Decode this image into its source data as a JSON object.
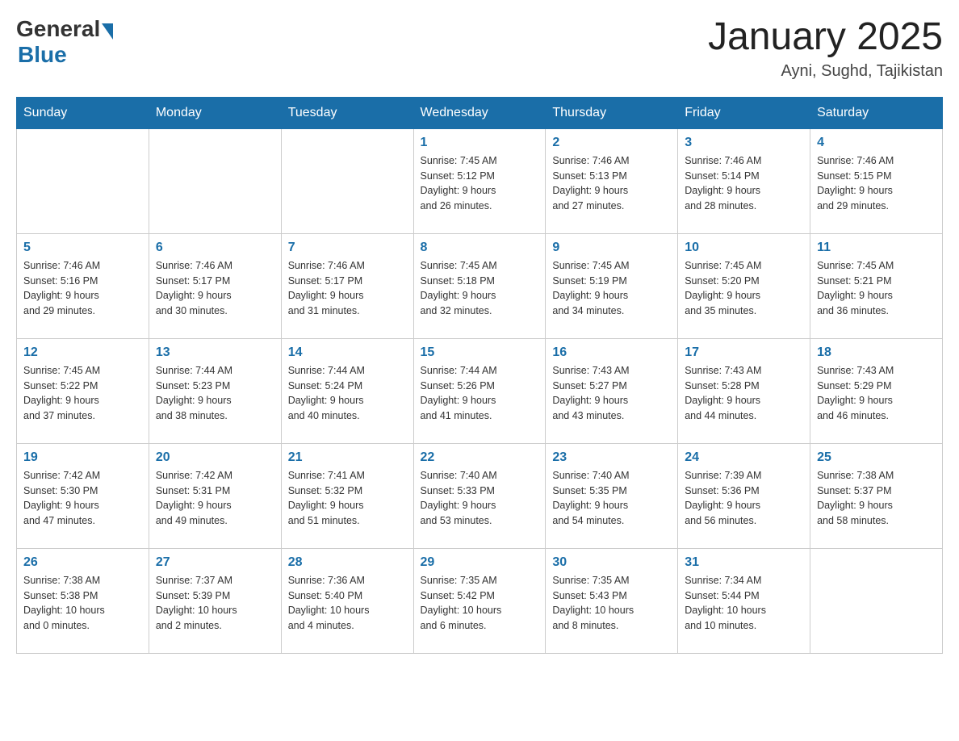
{
  "logo": {
    "general": "General",
    "blue": "Blue"
  },
  "title": "January 2025",
  "location": "Ayni, Sughd, Tajikistan",
  "days_of_week": [
    "Sunday",
    "Monday",
    "Tuesday",
    "Wednesday",
    "Thursday",
    "Friday",
    "Saturday"
  ],
  "weeks": [
    [
      {
        "day": "",
        "info": ""
      },
      {
        "day": "",
        "info": ""
      },
      {
        "day": "",
        "info": ""
      },
      {
        "day": "1",
        "info": "Sunrise: 7:45 AM\nSunset: 5:12 PM\nDaylight: 9 hours\nand 26 minutes."
      },
      {
        "day": "2",
        "info": "Sunrise: 7:46 AM\nSunset: 5:13 PM\nDaylight: 9 hours\nand 27 minutes."
      },
      {
        "day": "3",
        "info": "Sunrise: 7:46 AM\nSunset: 5:14 PM\nDaylight: 9 hours\nand 28 minutes."
      },
      {
        "day": "4",
        "info": "Sunrise: 7:46 AM\nSunset: 5:15 PM\nDaylight: 9 hours\nand 29 minutes."
      }
    ],
    [
      {
        "day": "5",
        "info": "Sunrise: 7:46 AM\nSunset: 5:16 PM\nDaylight: 9 hours\nand 29 minutes."
      },
      {
        "day": "6",
        "info": "Sunrise: 7:46 AM\nSunset: 5:17 PM\nDaylight: 9 hours\nand 30 minutes."
      },
      {
        "day": "7",
        "info": "Sunrise: 7:46 AM\nSunset: 5:17 PM\nDaylight: 9 hours\nand 31 minutes."
      },
      {
        "day": "8",
        "info": "Sunrise: 7:45 AM\nSunset: 5:18 PM\nDaylight: 9 hours\nand 32 minutes."
      },
      {
        "day": "9",
        "info": "Sunrise: 7:45 AM\nSunset: 5:19 PM\nDaylight: 9 hours\nand 34 minutes."
      },
      {
        "day": "10",
        "info": "Sunrise: 7:45 AM\nSunset: 5:20 PM\nDaylight: 9 hours\nand 35 minutes."
      },
      {
        "day": "11",
        "info": "Sunrise: 7:45 AM\nSunset: 5:21 PM\nDaylight: 9 hours\nand 36 minutes."
      }
    ],
    [
      {
        "day": "12",
        "info": "Sunrise: 7:45 AM\nSunset: 5:22 PM\nDaylight: 9 hours\nand 37 minutes."
      },
      {
        "day": "13",
        "info": "Sunrise: 7:44 AM\nSunset: 5:23 PM\nDaylight: 9 hours\nand 38 minutes."
      },
      {
        "day": "14",
        "info": "Sunrise: 7:44 AM\nSunset: 5:24 PM\nDaylight: 9 hours\nand 40 minutes."
      },
      {
        "day": "15",
        "info": "Sunrise: 7:44 AM\nSunset: 5:26 PM\nDaylight: 9 hours\nand 41 minutes."
      },
      {
        "day": "16",
        "info": "Sunrise: 7:43 AM\nSunset: 5:27 PM\nDaylight: 9 hours\nand 43 minutes."
      },
      {
        "day": "17",
        "info": "Sunrise: 7:43 AM\nSunset: 5:28 PM\nDaylight: 9 hours\nand 44 minutes."
      },
      {
        "day": "18",
        "info": "Sunrise: 7:43 AM\nSunset: 5:29 PM\nDaylight: 9 hours\nand 46 minutes."
      }
    ],
    [
      {
        "day": "19",
        "info": "Sunrise: 7:42 AM\nSunset: 5:30 PM\nDaylight: 9 hours\nand 47 minutes."
      },
      {
        "day": "20",
        "info": "Sunrise: 7:42 AM\nSunset: 5:31 PM\nDaylight: 9 hours\nand 49 minutes."
      },
      {
        "day": "21",
        "info": "Sunrise: 7:41 AM\nSunset: 5:32 PM\nDaylight: 9 hours\nand 51 minutes."
      },
      {
        "day": "22",
        "info": "Sunrise: 7:40 AM\nSunset: 5:33 PM\nDaylight: 9 hours\nand 53 minutes."
      },
      {
        "day": "23",
        "info": "Sunrise: 7:40 AM\nSunset: 5:35 PM\nDaylight: 9 hours\nand 54 minutes."
      },
      {
        "day": "24",
        "info": "Sunrise: 7:39 AM\nSunset: 5:36 PM\nDaylight: 9 hours\nand 56 minutes."
      },
      {
        "day": "25",
        "info": "Sunrise: 7:38 AM\nSunset: 5:37 PM\nDaylight: 9 hours\nand 58 minutes."
      }
    ],
    [
      {
        "day": "26",
        "info": "Sunrise: 7:38 AM\nSunset: 5:38 PM\nDaylight: 10 hours\nand 0 minutes."
      },
      {
        "day": "27",
        "info": "Sunrise: 7:37 AM\nSunset: 5:39 PM\nDaylight: 10 hours\nand 2 minutes."
      },
      {
        "day": "28",
        "info": "Sunrise: 7:36 AM\nSunset: 5:40 PM\nDaylight: 10 hours\nand 4 minutes."
      },
      {
        "day": "29",
        "info": "Sunrise: 7:35 AM\nSunset: 5:42 PM\nDaylight: 10 hours\nand 6 minutes."
      },
      {
        "day": "30",
        "info": "Sunrise: 7:35 AM\nSunset: 5:43 PM\nDaylight: 10 hours\nand 8 minutes."
      },
      {
        "day": "31",
        "info": "Sunrise: 7:34 AM\nSunset: 5:44 PM\nDaylight: 10 hours\nand 10 minutes."
      },
      {
        "day": "",
        "info": ""
      }
    ]
  ]
}
